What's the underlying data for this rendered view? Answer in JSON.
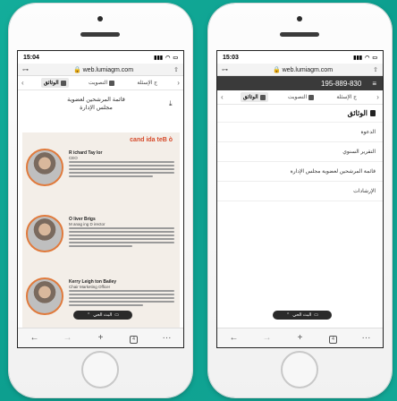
{
  "left": {
    "time": "15:04",
    "url": "web.lumiagm.com",
    "tabs": {
      "documents": "الوثائق",
      "voting": "التصويت",
      "questions": "ج الإسئلة"
    },
    "doc_title_line1": "قائمة المرشحين لعضوية",
    "doc_title_line2": "مجلس الإدارة",
    "candidates_heading": "cand ida teB ò",
    "people": [
      {
        "name": "R ichard Tay lor",
        "role": "CEO"
      },
      {
        "name": "O liver Brigs",
        "role": "M anag ing D irector"
      },
      {
        "name": "Kerry Leigh ton Bailey",
        "role": "Chair Marketing Officer"
      }
    ],
    "pill_label": "البث الحي"
  },
  "right": {
    "time": "15:03",
    "url": "web.lumiagm.com",
    "phone_number": "195-889-830",
    "tabs": {
      "documents": "الوثائق",
      "voting": "التصويت",
      "questions": "ج الإسئلة"
    },
    "section_title": "الوثائق",
    "items": [
      "الدعوة",
      "التقرير السنوي",
      "قائمة المرشحين لعضوية مجلس الإدارة",
      "الإرشادات"
    ],
    "pill_label": "البث الحي"
  },
  "colors": {
    "accent": "#d64a2a",
    "background": "#13ad9a",
    "header_bar": "#3a3a3a"
  }
}
